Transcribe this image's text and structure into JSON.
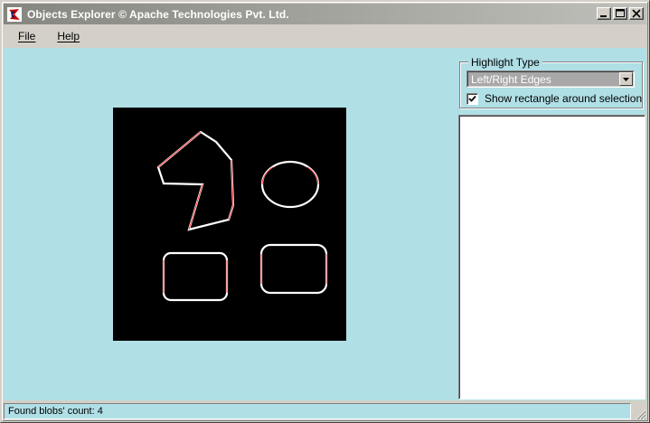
{
  "window": {
    "title": "Objects Explorer © Apache Technologies Pvt. Ltd.",
    "icon": "app-logo-icon",
    "controls": [
      "minimize-icon",
      "maximize-icon",
      "close-icon"
    ]
  },
  "menu": {
    "items": [
      {
        "label": "File"
      },
      {
        "label": "Help"
      }
    ]
  },
  "highlight": {
    "group_label": "Highlight Type",
    "selected_type": "Left/Right Edges",
    "show_rect_label": "Show rectangle around selection",
    "show_rect_checked": true
  },
  "status": {
    "text": "Found blobs' count: 4"
  },
  "colors": {
    "client_bg": "#b0dfe6",
    "canvas_bg": "#000000",
    "shape_outline": "#ffffff",
    "edge_highlight": "#ff0000",
    "title_gradient_start": "#868680",
    "title_gradient_end": "#c0c0bb"
  }
}
